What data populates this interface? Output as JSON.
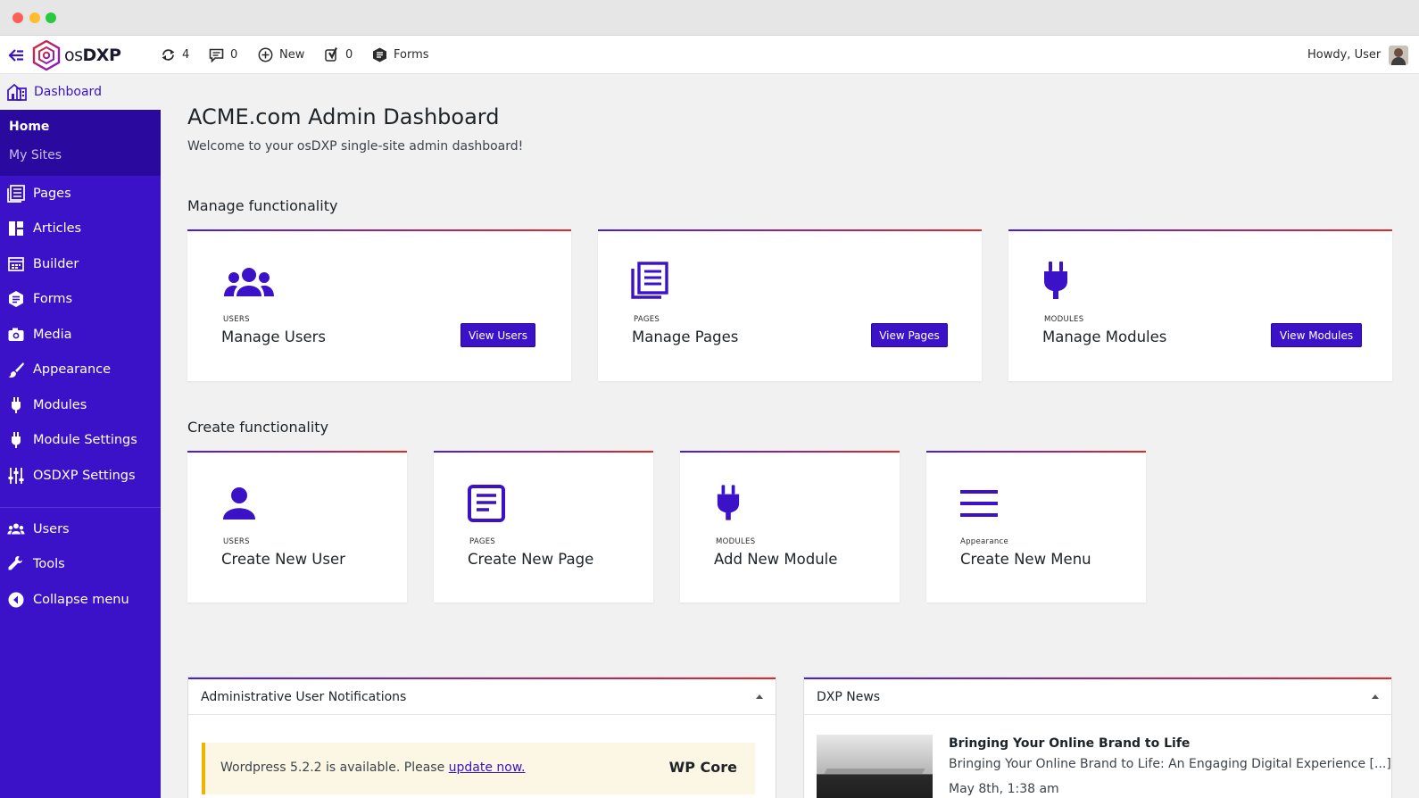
{
  "colors": {
    "accent": "#3b12c7",
    "accent_dark": "#2a0a9e",
    "gradient_end": "#e02a2a",
    "notice_border": "#f0b400"
  },
  "adminbar": {
    "logo_text_light": "os",
    "logo_text_bold": "DXP",
    "updates_count": "4",
    "comments_count": "0",
    "new_label": "New",
    "yoast_count": "0",
    "forms_label": "Forms",
    "howdy": "Howdy, User"
  },
  "sidebar": {
    "dashboard": "Dashboard",
    "sub_home": "Home",
    "sub_sites": "My Sites",
    "items": [
      {
        "label": "Pages",
        "icon": "pages-icon"
      },
      {
        "label": "Articles",
        "icon": "articles-icon"
      },
      {
        "label": "Builder",
        "icon": "builder-icon"
      },
      {
        "label": "Forms",
        "icon": "forms-icon"
      },
      {
        "label": "Media",
        "icon": "camera-icon"
      },
      {
        "label": "Appearance",
        "icon": "brush-icon"
      },
      {
        "label": "Modules",
        "icon": "plug-icon"
      },
      {
        "label": "Module Settings",
        "icon": "plug-icon"
      },
      {
        "label": "OSDXP Settings",
        "icon": "sliders-icon"
      },
      {
        "label": "Users",
        "icon": "users-icon"
      },
      {
        "label": "Tools",
        "icon": "wrench-icon"
      },
      {
        "label": "Collapse menu",
        "icon": "collapse-icon"
      }
    ]
  },
  "main": {
    "title": "ACME.com Admin Dashboard",
    "subtitle": "Welcome to your osDXP single-site admin dashboard!",
    "manage_heading": "Manage functionality",
    "create_heading": "Create functionality",
    "manage_cards": [
      {
        "caption": "USERS",
        "title": "Manage Users",
        "button": "View Users",
        "icon": "users-icon"
      },
      {
        "caption": "PAGES",
        "title": "Manage Pages",
        "button": "View Pages",
        "icon": "pages-icon"
      },
      {
        "caption": "MODULES",
        "title": "Manage Modules",
        "button": "View Modules",
        "icon": "plug-icon"
      }
    ],
    "create_cards": [
      {
        "caption": "USERS",
        "title": "Create New User",
        "icon": "user-icon"
      },
      {
        "caption": "PAGES",
        "title": "Create New Page",
        "icon": "document-icon"
      },
      {
        "caption": "MODULES",
        "title": "Add New Module",
        "icon": "plug-icon"
      },
      {
        "caption": "Appearance",
        "title": "Create New Menu",
        "icon": "menu-icon"
      }
    ]
  },
  "widgets": {
    "notifications": {
      "title": "Administrative User Notifications",
      "notice_text": "Wordpress 5.2.2 is available. Please ",
      "notice_link": "update now.",
      "notice_tag": "WP Core"
    },
    "news": {
      "title": "DXP News",
      "item_title": "Bringing Your Online Brand to Life",
      "item_excerpt": "Bringing Your Online Brand to Life: An Engaging Digital Experience [...]",
      "item_date": "May 8th, 1:38 am"
    }
  }
}
